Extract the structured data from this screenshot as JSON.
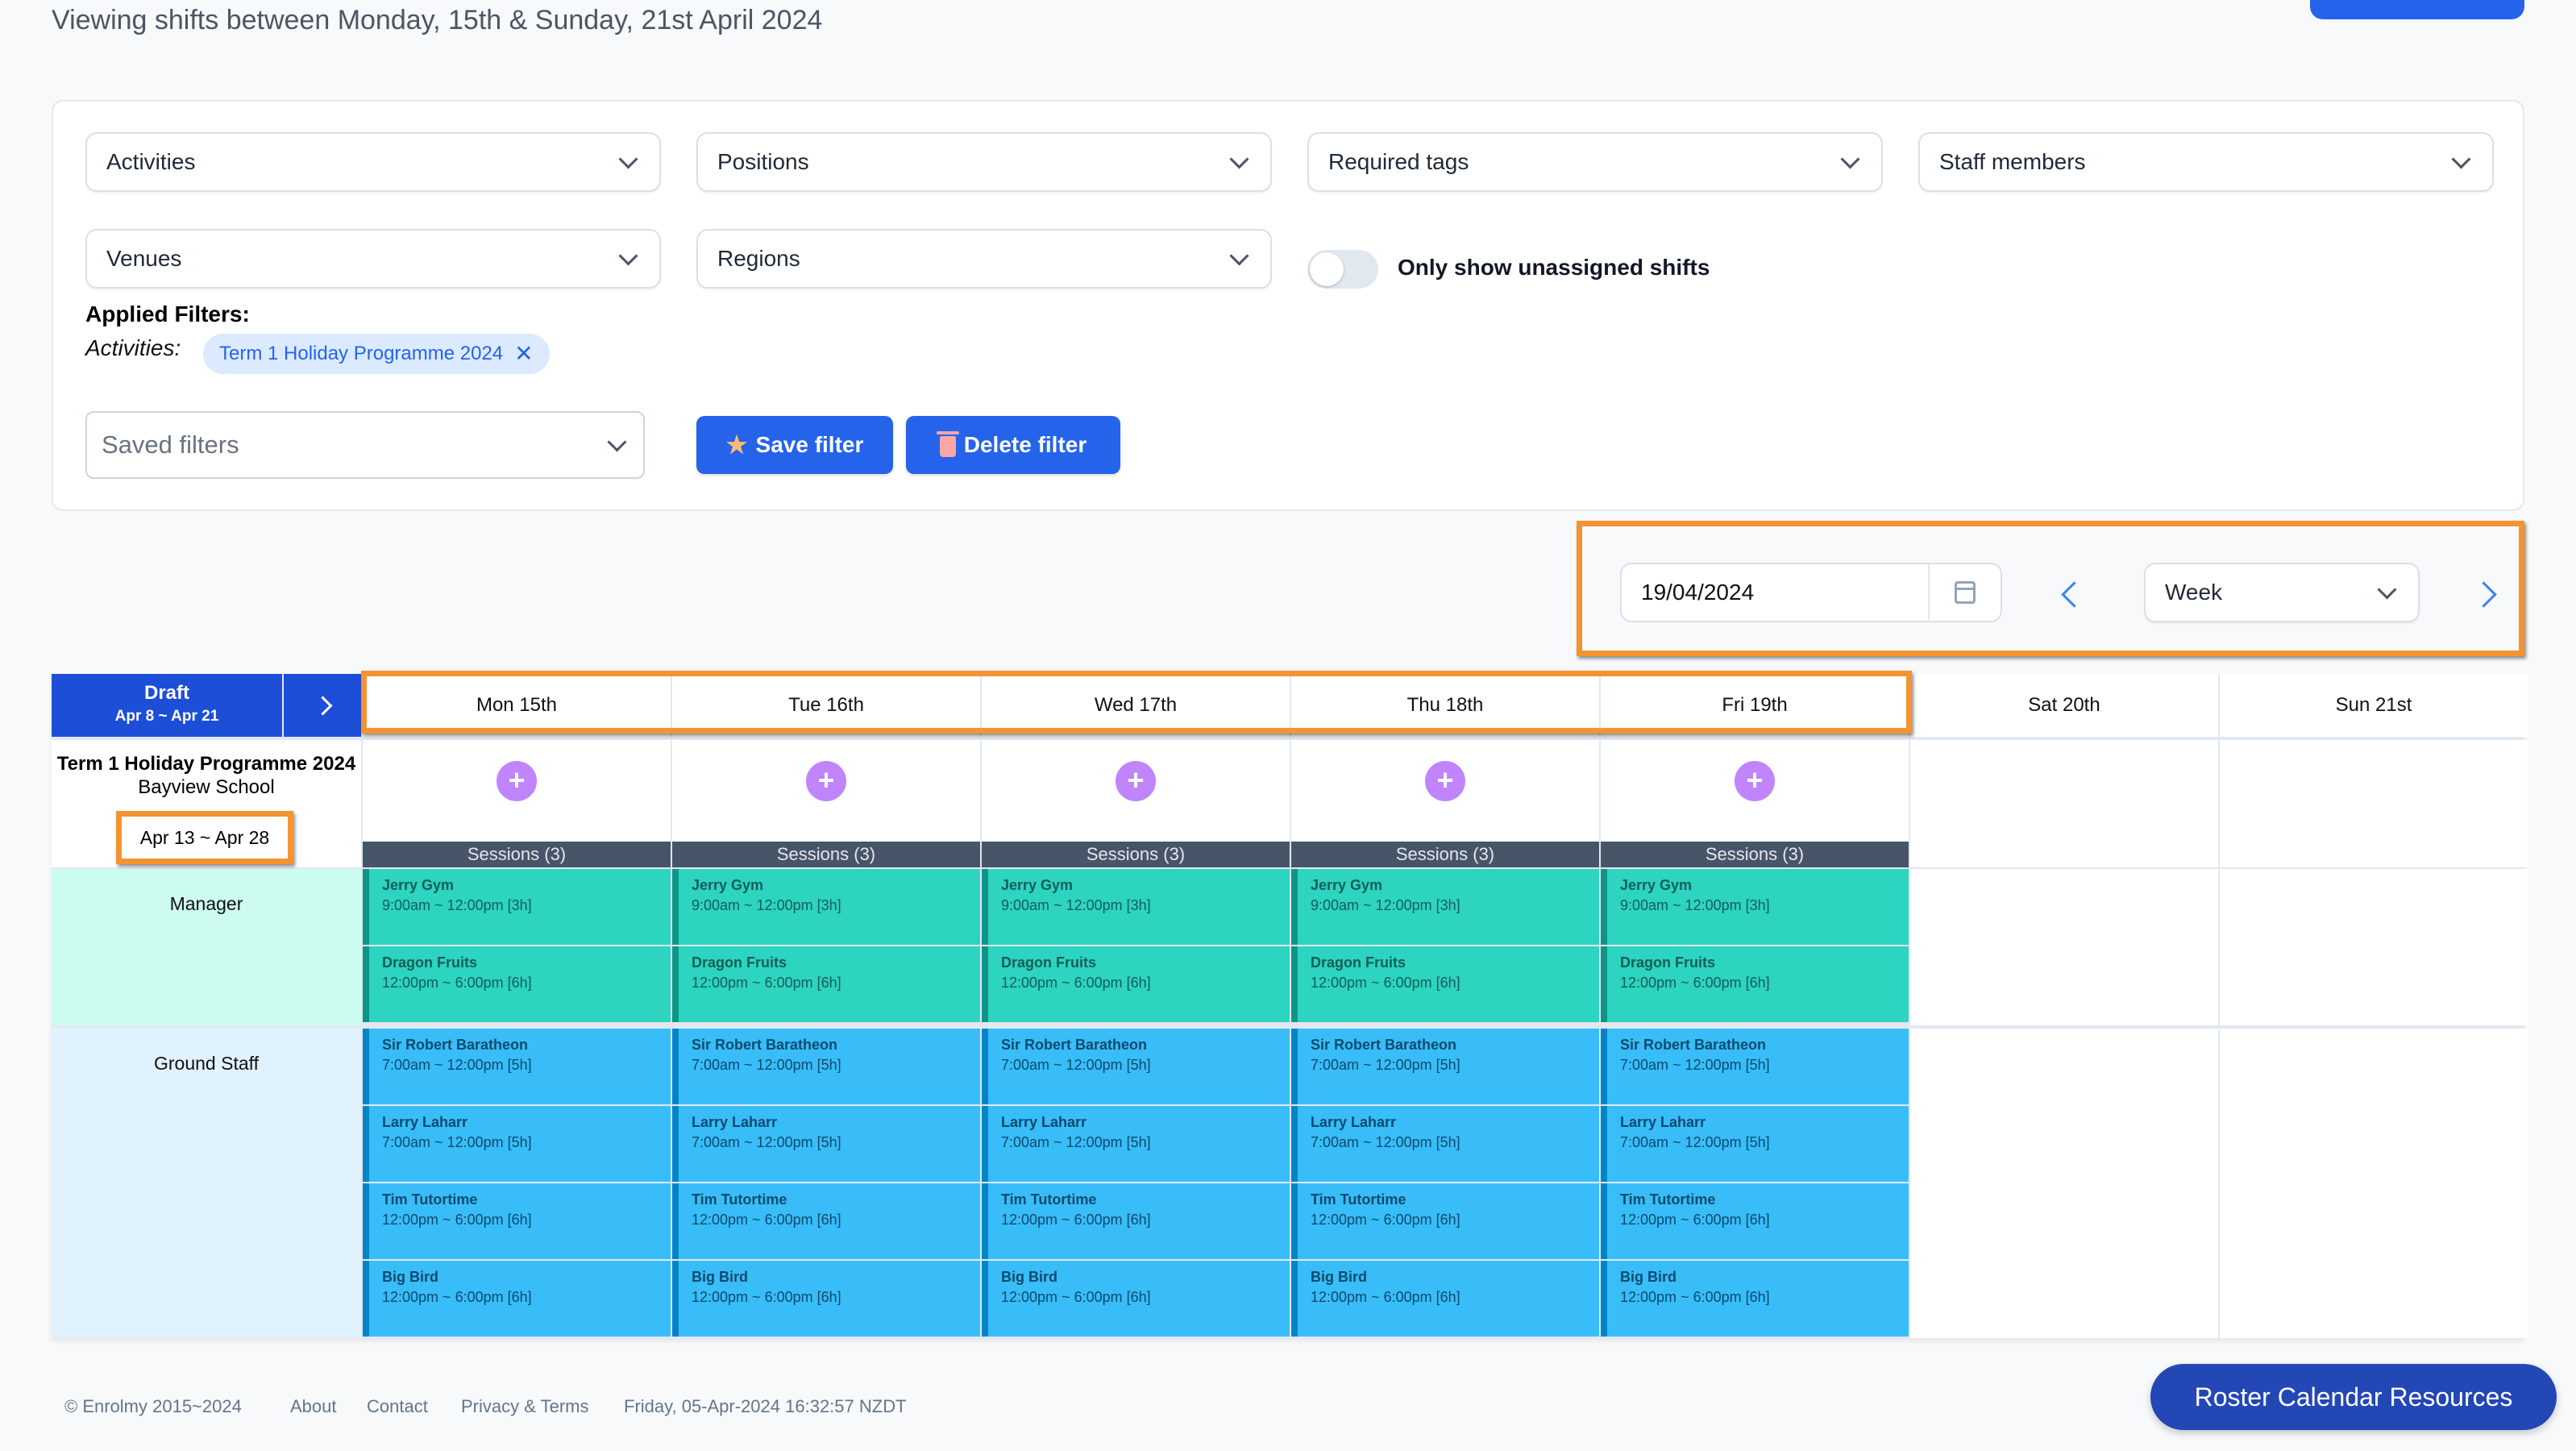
{
  "page_title": "Viewing shifts between Monday, 15th & Sunday, 21st April 2024",
  "filters": {
    "selects": [
      {
        "label": "Activities"
      },
      {
        "label": "Positions"
      },
      {
        "label": "Required tags"
      },
      {
        "label": "Staff members"
      },
      {
        "label": "Venues"
      },
      {
        "label": "Regions"
      }
    ],
    "toggle_label": "Only show unassigned shifts",
    "toggle_on": false,
    "applied_title": "Applied Filters:",
    "applied_key": "Activities:",
    "applied_chip": "Term 1 Holiday Programme 2024",
    "saved_filters_placeholder": "Saved filters",
    "save_button": "Save filter",
    "delete_button": "Delete filter"
  },
  "date_nav": {
    "date_value": "19/04/2024",
    "view_select": "Week"
  },
  "roster": {
    "draft_label": "Draft",
    "draft_range": "Apr 8 ~ Apr 21",
    "days": [
      "Mon 15th",
      "Tue 16th",
      "Wed 17th",
      "Thu 18th",
      "Fri 19th",
      "Sat 20th",
      "Sun 21st"
    ],
    "activity": {
      "title": "Term 1 Holiday Programme 2024",
      "venue": "Bayview School",
      "dates": "Apr 13 ~ Apr 28"
    },
    "sessions_label": "Sessions (3)",
    "roles": [
      {
        "name": "Manager",
        "color": "#2dd4bf",
        "shifts": [
          {
            "name": "Jerry Gym",
            "time": "9:00am ~ 12:00pm [3h]"
          },
          {
            "name": "Dragon Fruits",
            "time": "12:00pm ~ 6:00pm [6h]"
          }
        ]
      },
      {
        "name": "Ground Staff",
        "color": "#38bdf8",
        "shifts": [
          {
            "name": "Sir Robert Baratheon",
            "time": "7:00am ~ 12:00pm [5h]"
          },
          {
            "name": "Larry Laharr",
            "time": "7:00am ~ 12:00pm [5h]"
          },
          {
            "name": "Tim Tutortime",
            "time": "12:00pm ~ 6:00pm [6h]"
          },
          {
            "name": "Big Bird",
            "time": "12:00pm ~ 6:00pm [6h]"
          }
        ]
      }
    ],
    "active_days": 5
  },
  "footer": {
    "copyright": "© Enrolmy  2015~2024",
    "links": [
      "About",
      "Contact",
      "Privacy & Terms"
    ],
    "timestamp": "Friday, 05-Apr-2024 16:32:57 NZDT"
  },
  "resources_button": "Roster Calendar Resources",
  "colors": {
    "primary": "#2563eb",
    "highlight": "#f59331",
    "add": "#c084fc"
  }
}
